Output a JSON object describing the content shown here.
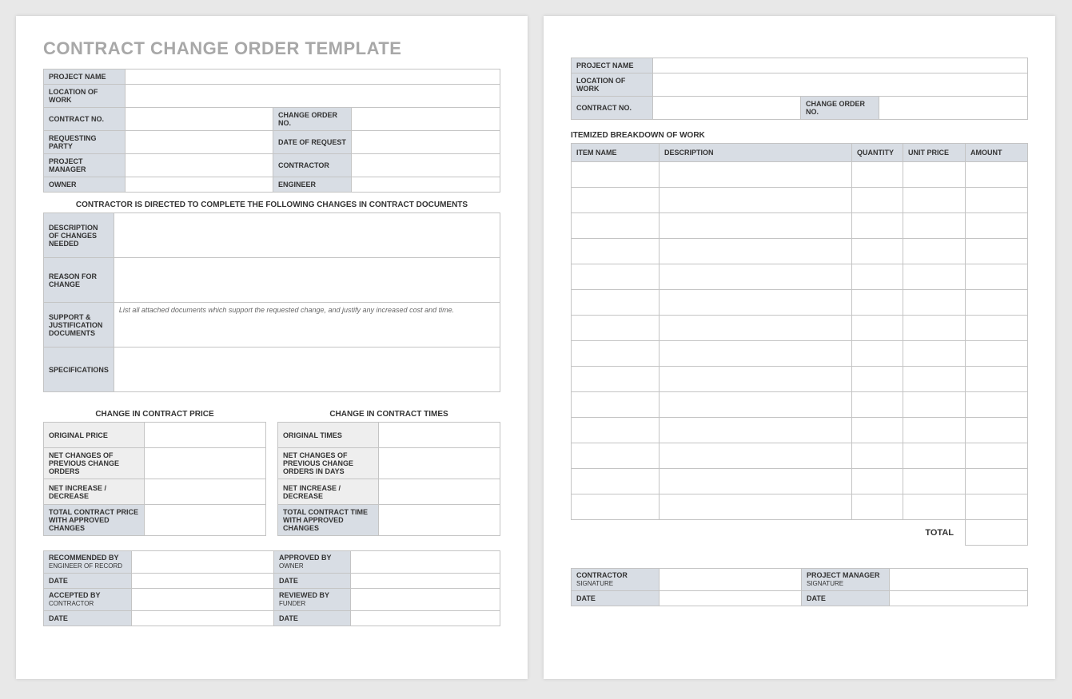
{
  "title": "CONTRACT CHANGE ORDER TEMPLATE",
  "header": {
    "project_name": "PROJECT NAME",
    "location_of_work": "LOCATION OF WORK",
    "contract_no": "CONTRACT NO.",
    "change_order_no": "CHANGE ORDER NO.",
    "requesting_party": "REQUESTING PARTY",
    "date_of_request": "DATE OF REQUEST",
    "project_manager": "PROJECT MANAGER",
    "contractor": "CONTRACTOR",
    "owner": "OWNER",
    "engineer": "ENGINEER"
  },
  "directive": "CONTRACTOR IS DIRECTED TO COMPLETE THE FOLLOWING CHANGES IN CONTRACT DOCUMENTS",
  "changes": {
    "description_label": "DESCRIPTION OF CHANGES NEEDED",
    "reason_label": "REASON FOR CHANGE",
    "support_label": "SUPPORT & JUSTIFICATION DOCUMENTS",
    "support_hint": "List all attached documents which support the requested change, and justify any increased cost and time.",
    "specifications_label": "SPECIFICATIONS"
  },
  "price": {
    "title": "CHANGE IN CONTRACT PRICE",
    "original": "ORIGINAL PRICE",
    "net_prev": "NET CHANGES OF PREVIOUS CHANGE ORDERS",
    "net_inc": "NET INCREASE / DECREASE",
    "total": "TOTAL CONTRACT PRICE WITH APPROVED CHANGES"
  },
  "times": {
    "title": "CHANGE IN CONTRACT TIMES",
    "original": "ORIGINAL TIMES",
    "net_prev": "NET CHANGES OF PREVIOUS CHANGE ORDERS IN DAYS",
    "net_inc": "NET INCREASE / DECREASE",
    "total": "TOTAL CONTRACT TIME WITH APPROVED CHANGES"
  },
  "sig1": {
    "recommended_by": "RECOMMENDED BY",
    "engineer_of_record": "ENGINEER OF RECORD",
    "approved_by": "APPROVED BY",
    "owner": "OWNER",
    "date": "DATE",
    "accepted_by": "ACCEPTED BY",
    "contractor": "CONTRACTOR",
    "reviewed_by": "REVIEWED BY",
    "funder": "FUNDER"
  },
  "page2": {
    "itemized_title": "ITEMIZED BREAKDOWN OF WORK",
    "columns": {
      "item_name": "ITEM NAME",
      "description": "DESCRIPTION",
      "quantity": "QUANTITY",
      "unit_price": "UNIT PRICE",
      "amount": "AMOUNT"
    },
    "total": "TOTAL",
    "sig": {
      "contractor": "CONTRACTOR",
      "signature": "SIGNATURE",
      "project_manager": "PROJECT MANAGER",
      "date": "DATE"
    }
  }
}
